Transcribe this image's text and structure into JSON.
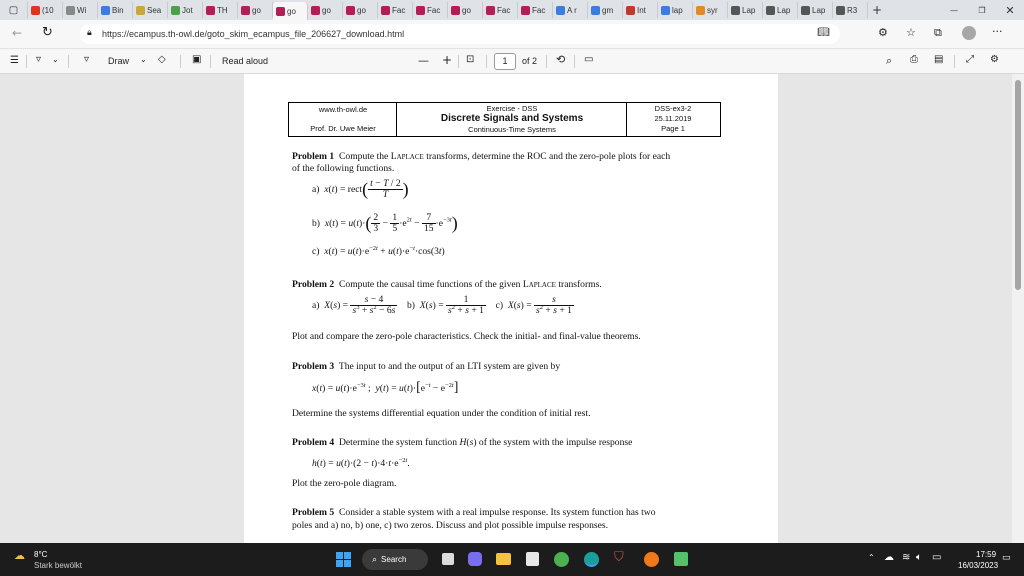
{
  "browser": {
    "tabs": [
      {
        "label": "(10",
        "color": "#e0321c"
      },
      {
        "label": "Wi",
        "color": "#888"
      },
      {
        "label": "Bin",
        "color": "#3b7de0"
      },
      {
        "label": "Sea",
        "color": "#c8a73c"
      },
      {
        "label": "Jot",
        "color": "#4aa14a"
      },
      {
        "label": "TH",
        "color": "#b21e55"
      },
      {
        "label": "go",
        "color": "#b21e55"
      },
      {
        "label": "go",
        "color": "#b21e55"
      },
      {
        "label": "go",
        "color": "#b21e55"
      },
      {
        "label": "go",
        "color": "#b21e55"
      },
      {
        "label": "Fac",
        "color": "#b21e55"
      },
      {
        "label": "Fac",
        "color": "#b21e55"
      },
      {
        "label": "go",
        "color": "#b21e55"
      },
      {
        "label": "Fac",
        "color": "#b21e55"
      },
      {
        "label": "Fac",
        "color": "#b21e55"
      },
      {
        "label": "A r",
        "color": "#3b7de0"
      },
      {
        "label": "gm",
        "color": "#3b7de0"
      },
      {
        "label": "Int",
        "color": "#c0392b"
      },
      {
        "label": "lap",
        "color": "#3b7de0"
      },
      {
        "label": "syr",
        "color": "#e08a2a"
      },
      {
        "label": "Lap",
        "color": "#555"
      },
      {
        "label": "Lap",
        "color": "#555"
      },
      {
        "label": "Lap",
        "color": "#555"
      },
      {
        "label": "R3",
        "color": "#555"
      }
    ],
    "url": "https://ecampus.th-owl.de/goto_skim_ecampus_file_206627_download.html"
  },
  "pdf_toolbar": {
    "draw_label": "Draw",
    "read_aloud_label": "Read aloud",
    "page_current": "1",
    "page_total": "of 2"
  },
  "document": {
    "header": {
      "site": "www.th-owl.de",
      "author": "Prof. Dr. Uwe Meier",
      "exercise": "Exercise - DSS",
      "course": "Discrete Signals and Systems",
      "subtitle": "Continuous-Time Systems",
      "code": "DSS-ex3-2",
      "date": "25.11.2019",
      "page": "Page 1"
    },
    "problems": {
      "p1_title": "Problem 1",
      "p1_text_a": "Compute the ",
      "p1_laplace": "Laplace",
      "p1_text_b": " transforms, determine the ROC and the zero-pole plots for each",
      "p1_text_c": "of the following functions.",
      "p2_title": "Problem 2",
      "p2_text_a": "Compute the causal time functions of the given ",
      "p2_laplace": "Laplace",
      "p2_text_b": " transforms.",
      "p2_after": "Plot and compare the zero-pole characteristics. Check the initial- and final-value theorems.",
      "p3_title": "Problem 3",
      "p3_text": "The input to and the output of an LTI system are given by",
      "p3_after": "Determine the systems differential equation under the condition of initial rest.",
      "p4_title": "Problem 4",
      "p4_text_a": "Determine the system function ",
      "p4_text_b": " of the system with the impulse response",
      "p4_after": "Plot the zero-pole diagram.",
      "p5_title": "Problem 5",
      "p5_text_a": "Consider a stable system with a real impulse response. Its system function has two",
      "p5_text_b": "poles and a) no, b) one, c) two zeros. Discuss and plot possible impulse responses."
    }
  },
  "taskbar": {
    "weather_temp": "8°C",
    "weather_desc": "Stark bewölkt",
    "search_label": "Search",
    "time": "17:59",
    "date": "16/03/2023"
  }
}
